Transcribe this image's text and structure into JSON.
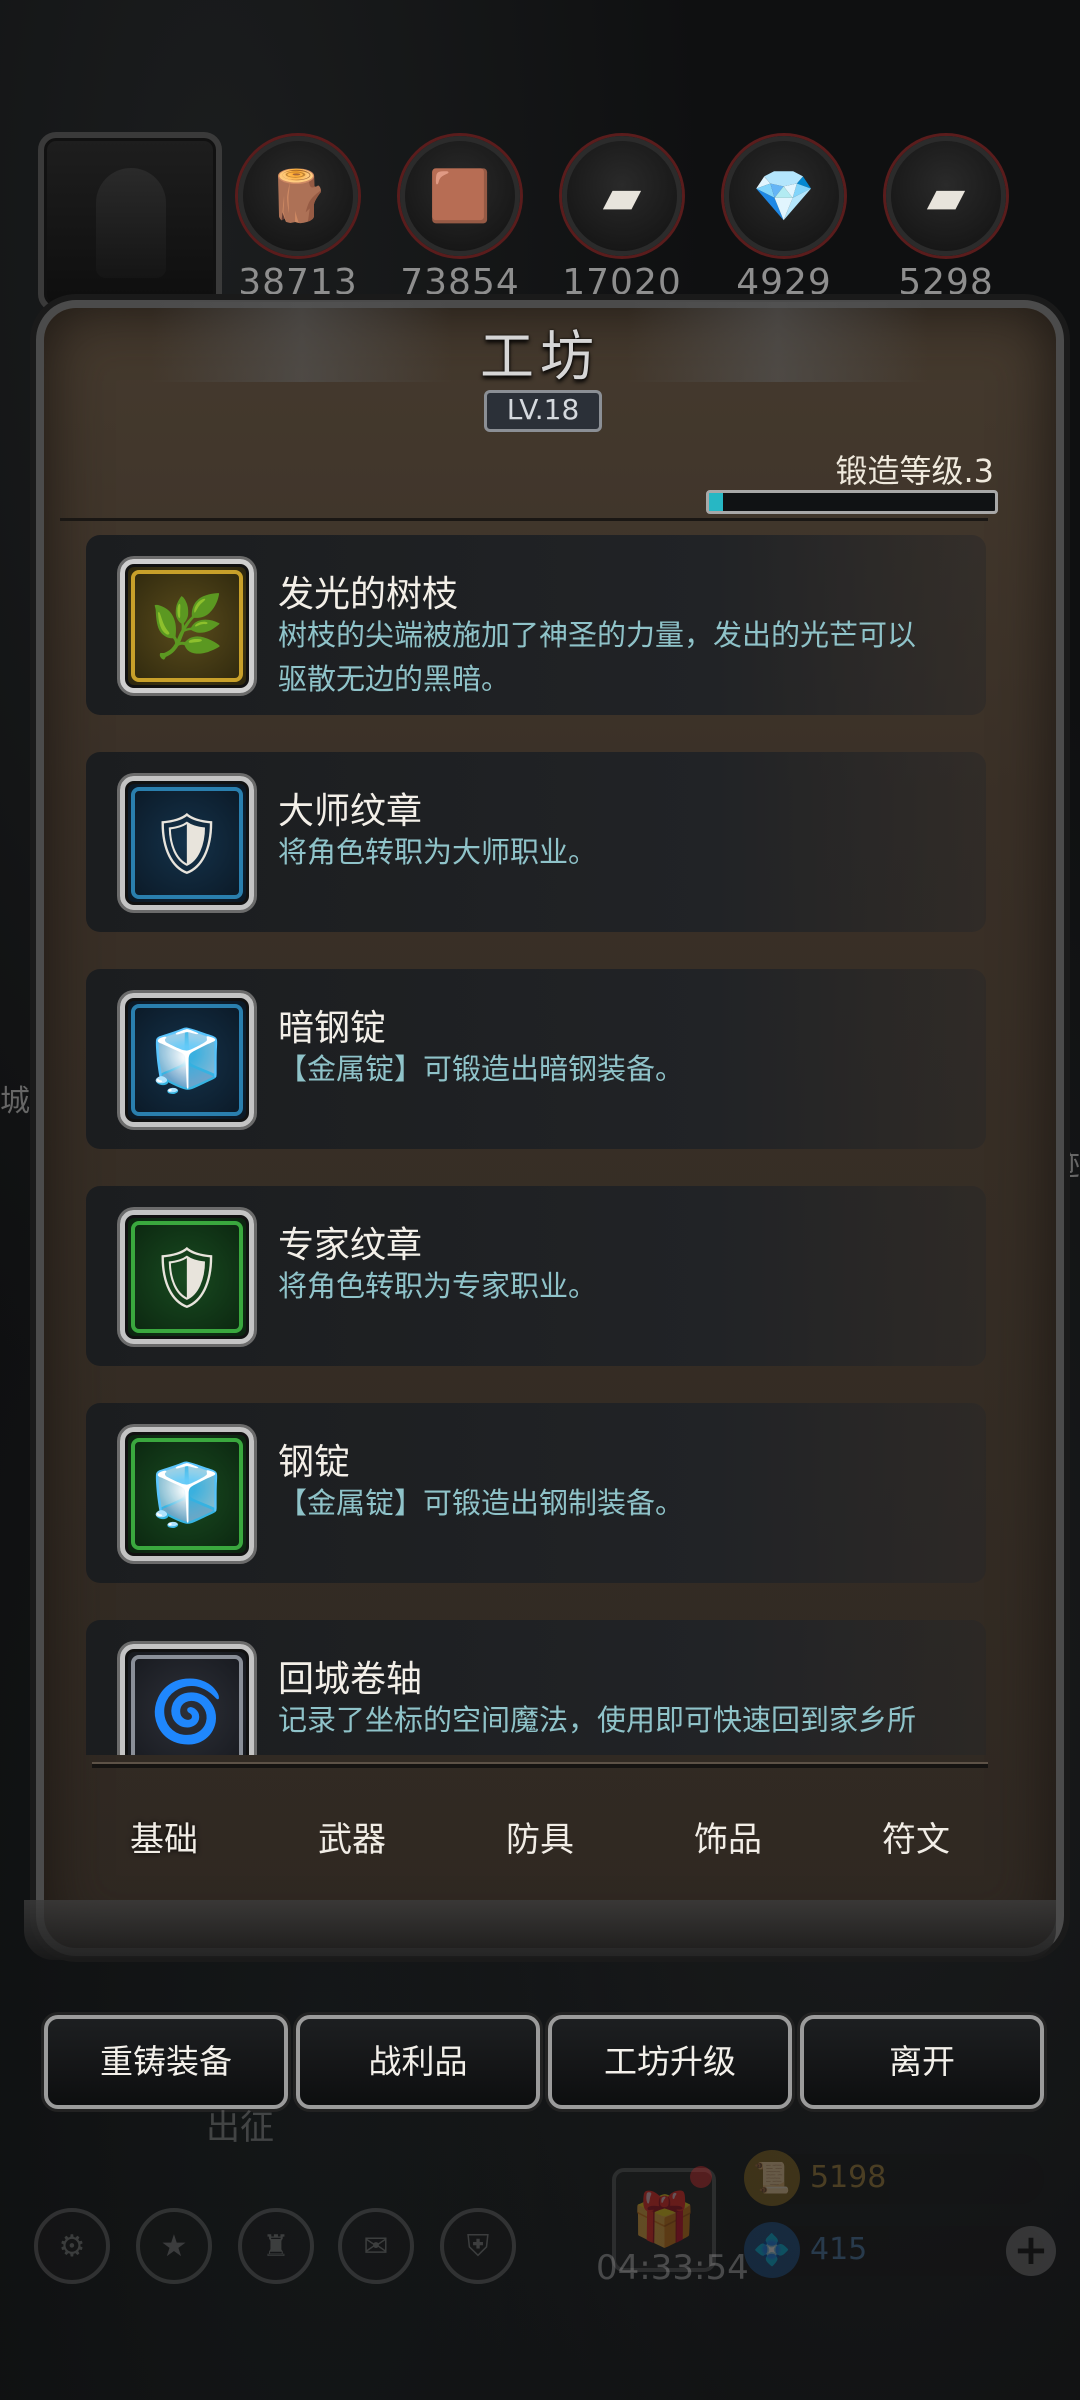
{
  "resources": [
    {
      "icon": "wood-log-icon",
      "glyph": "🪵",
      "value": "38713"
    },
    {
      "icon": "plank-icon",
      "glyph": "🟫",
      "value": "73854"
    },
    {
      "icon": "iron-ingot-icon",
      "glyph": "▰",
      "value": "17020"
    },
    {
      "icon": "crystal-icon",
      "glyph": "💎",
      "value": "4929"
    },
    {
      "icon": "steel-ingot-icon",
      "glyph": "▰",
      "value": "5298"
    }
  ],
  "panel": {
    "title": "工坊",
    "level": "LV.18",
    "forge_level_label": "锻造等级.3",
    "forge_progress": 0.05
  },
  "items": [
    {
      "name": "发光的树枝",
      "desc": "树枝的尖端被施加了神圣的力量，发出的光芒可以驱散无边的黑暗。",
      "frame": "gold",
      "icon": "glowing-branch-icon",
      "glyph": "🌿"
    },
    {
      "name": "大师纹章",
      "desc": "将角色转职为大师职业。",
      "frame": "blue",
      "icon": "master-emblem-icon",
      "glyph": "🛡"
    },
    {
      "name": "暗钢锭",
      "desc": "【金属锭】可锻造出暗钢装备。",
      "frame": "blue",
      "icon": "dark-steel-ingot-icon",
      "glyph": "🧊"
    },
    {
      "name": "专家纹章",
      "desc": "将角色转职为专家职业。",
      "frame": "green",
      "icon": "expert-emblem-icon",
      "glyph": "🛡"
    },
    {
      "name": "钢锭",
      "desc": "【金属锭】可锻造出钢制装备。",
      "frame": "green",
      "icon": "steel-ingot-icon",
      "glyph": "🧊"
    },
    {
      "name": "回城卷轴",
      "desc": "记录了坐标的空间魔法，使用即可快速回到家乡所",
      "frame": "gray",
      "icon": "return-scroll-icon",
      "glyph": "🌀"
    }
  ],
  "tabs": [
    "基础",
    "武器",
    "防具",
    "饰品",
    "符文"
  ],
  "active_tab": 0,
  "buttons": {
    "reforge": "重铸装备",
    "loot": "战利品",
    "upgrade": "工坊升级",
    "leave": "离开"
  },
  "hud": {
    "expedition": "出征",
    "timer": "04:33:54",
    "gold": "5198",
    "gems": "415",
    "left_edge_text": "城堡",
    "right_edge_text": "迹"
  },
  "colors": {
    "desc_text": "#8fc3c9",
    "progress_fill": "#27b7c4",
    "gold_text": "#b08a3a",
    "gem_text": "#4d7fb0"
  }
}
